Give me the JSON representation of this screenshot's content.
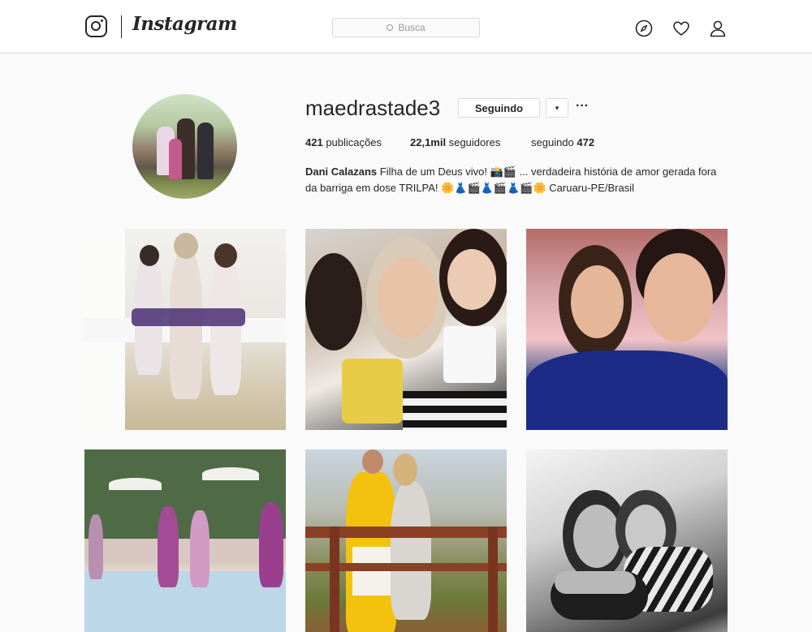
{
  "app": {
    "name": "Instagram"
  },
  "header": {
    "search_placeholder": "Busca",
    "icons": [
      "instagram-logo-icon",
      "compass-icon",
      "heart-icon",
      "user-icon"
    ]
  },
  "profile": {
    "username": "maedrastade3",
    "follow_label": "Seguindo",
    "dropdown_icon": "▾",
    "more_label": "···",
    "stats": {
      "posts_value": "421",
      "posts_label": "publicações",
      "followers_value": "22,1mil",
      "followers_label": "seguidores",
      "following_label": "seguindo",
      "following_value": "472"
    },
    "bio": {
      "name": "Dani Calazans",
      "text_line1": "Filha de um Deus vivo! 📸🎬 ... verdadeira história de amor gerada fora",
      "text_line2": "da barriga em dose TRILPA! 🌼👗🎬👗🎬👗🎬🌼 Caruaru-PE/Brasil"
    }
  },
  "posts": [
    {
      "alt": "post-1"
    },
    {
      "alt": "post-2"
    },
    {
      "alt": "post-3"
    },
    {
      "alt": "post-4"
    },
    {
      "alt": "post-5"
    },
    {
      "alt": "post-6"
    }
  ]
}
